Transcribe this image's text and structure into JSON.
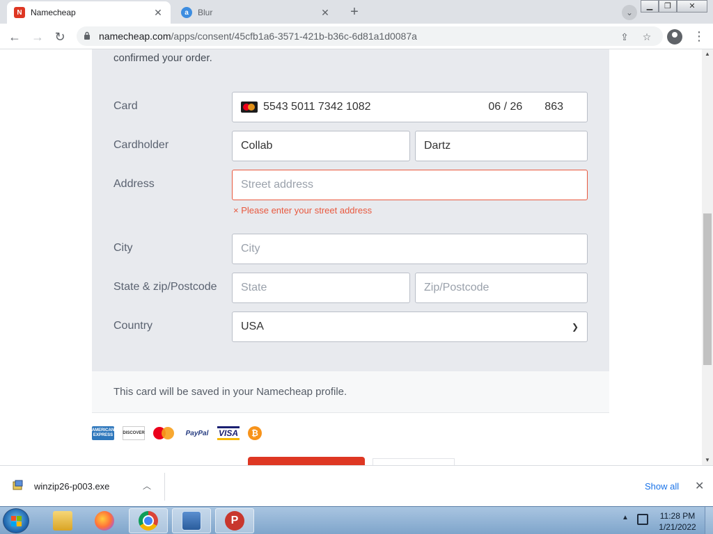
{
  "browser": {
    "tabs": [
      {
        "title": "Namecheap",
        "favicon": "namecheap-logo",
        "active": true
      },
      {
        "title": "Blur",
        "favicon": "blur-logo",
        "active": false
      }
    ],
    "url_host": "namecheap.com",
    "url_path": "/apps/consent/45cfb1a6-3571-421b-b36c-6d81a1d0087a",
    "accent": "#de3723"
  },
  "form": {
    "intro": "confirmed your order.",
    "labels": {
      "card": "Card",
      "cardholder": "Cardholder",
      "address": "Address",
      "city": "City",
      "state_zip": "State & zip/Postcode",
      "country": "Country"
    },
    "card_number": "5543 5011 7342 1082",
    "card_expiry": "06 / 26",
    "card_cvv": "863",
    "first_name": "Collab",
    "last_name": "Dartz",
    "address_placeholder": "Street address",
    "address_error": "× Please enter your street address",
    "city_placeholder": "City",
    "state_placeholder": "State",
    "zip_placeholder": "Zip/Postcode",
    "country_value": "USA",
    "error_color": "#e8583e"
  },
  "note": "This card will be saved in your Namecheap profile.",
  "payment_logos": [
    "amex",
    "discover",
    "mastercard",
    "paypal",
    "visa",
    "bitcoin"
  ],
  "payment_text": {
    "amex": "AMERICAN EXPRESS",
    "discover": "DISCOVER",
    "paypal": "PayPal",
    "visa": "VISA",
    "bitcoin": "₿"
  },
  "download": {
    "filename": "winzip26-p003.exe",
    "show_all": "Show all"
  },
  "taskbar": {
    "time": "11:28 PM",
    "date": "1/21/2022",
    "apps": [
      "windows-explorer",
      "firefox",
      "chrome",
      "remote-desktop",
      "proton-vpn"
    ]
  }
}
